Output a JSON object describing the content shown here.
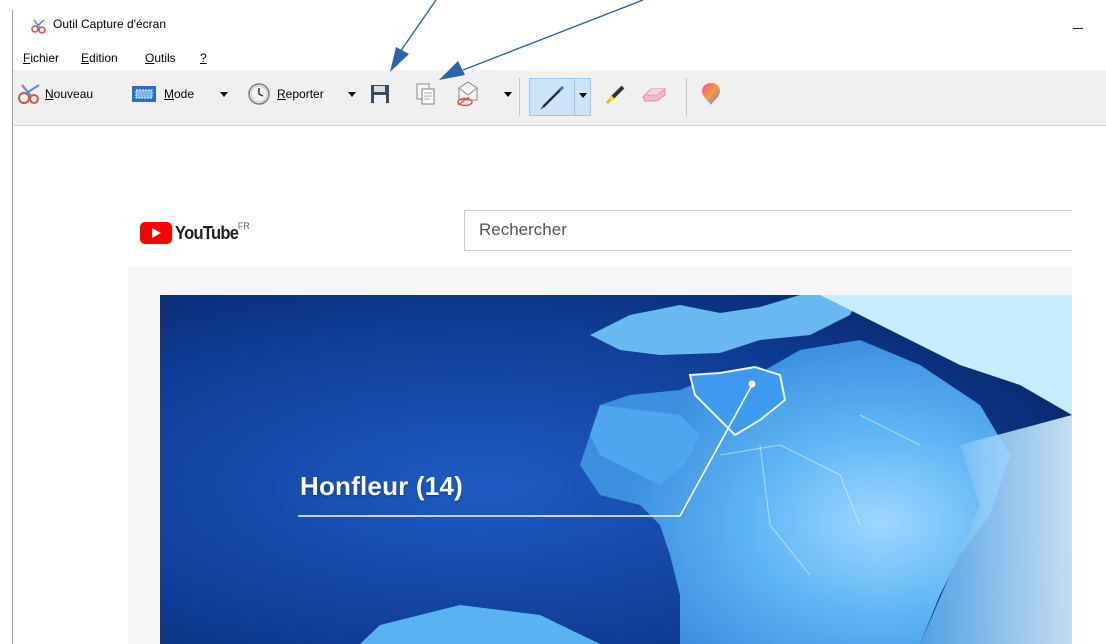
{
  "window": {
    "title": "Outil Capture d'écran"
  },
  "menubar": {
    "items": [
      {
        "label": "Fichier",
        "accel": "F",
        "rest": "ichier"
      },
      {
        "label": "Edition",
        "accel": "E",
        "rest": "dition"
      },
      {
        "label": "Outils",
        "accel": "O",
        "rest": "utils"
      },
      {
        "label": "?",
        "accel": "?",
        "rest": ""
      }
    ]
  },
  "toolbar": {
    "new_label_accel": "N",
    "new_label_rest": "ouveau",
    "mode_label_accel": "M",
    "mode_label_rest": "ode",
    "delay_label_accel": "R",
    "delay_label_rest": "eporter",
    "icons": {
      "new": "scissors-icon",
      "mode": "mode-rectangle-icon",
      "delay": "clock-icon",
      "save": "save-floppy-icon",
      "copy": "copy-icon",
      "send": "send-email-icon",
      "pen": "pen-icon",
      "highlighter": "highlighter-icon",
      "eraser": "eraser-icon",
      "paint3d": "paint-3d-icon"
    }
  },
  "content": {
    "youtube": {
      "wordmark": "YouTube",
      "region": "FR",
      "search_placeholder": "Rechercher"
    },
    "video": {
      "caption": "Honfleur (14)"
    }
  },
  "colors": {
    "accent_blue": "#3a6ea5",
    "youtube_red": "#ff0000",
    "selected_tool_bg": "#cce4f7"
  }
}
